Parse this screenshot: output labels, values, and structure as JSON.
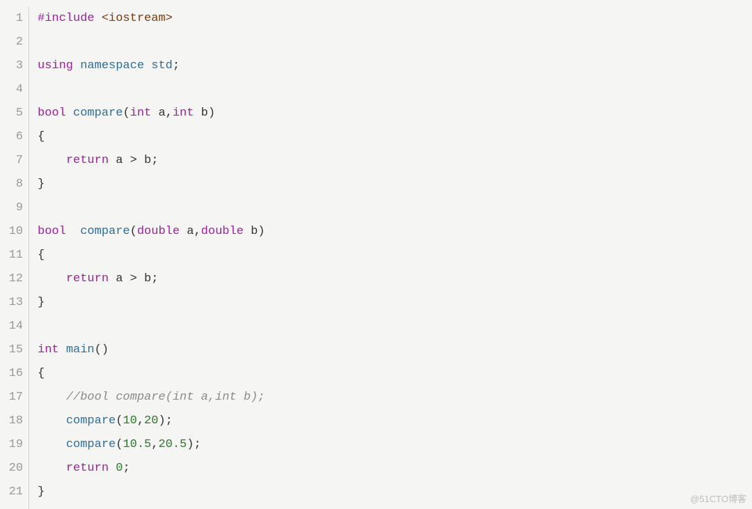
{
  "watermark": "@51CTO博客",
  "code": {
    "lines": [
      {
        "num": "1",
        "tokens": [
          {
            "t": "#include ",
            "c": "kw-preproc"
          },
          {
            "t": "<iostream>",
            "c": "kw-angle"
          }
        ]
      },
      {
        "num": "2",
        "tokens": []
      },
      {
        "num": "3",
        "tokens": [
          {
            "t": "using ",
            "c": "kw-using"
          },
          {
            "t": "namespace ",
            "c": "kw-ns"
          },
          {
            "t": "std",
            "c": "kw-ident"
          },
          {
            "t": ";",
            "c": "op"
          }
        ]
      },
      {
        "num": "4",
        "tokens": []
      },
      {
        "num": "5",
        "tokens": [
          {
            "t": "bool ",
            "c": "kw-type"
          },
          {
            "t": "compare",
            "c": "kw-func"
          },
          {
            "t": "(",
            "c": "op"
          },
          {
            "t": "int ",
            "c": "kw-type"
          },
          {
            "t": "a",
            "c": "op"
          },
          {
            "t": ",",
            "c": "op"
          },
          {
            "t": "int ",
            "c": "kw-type"
          },
          {
            "t": "b",
            "c": "op"
          },
          {
            "t": ")",
            "c": "op"
          }
        ]
      },
      {
        "num": "6",
        "tokens": [
          {
            "t": "{",
            "c": "brace"
          }
        ]
      },
      {
        "num": "7",
        "tokens": [
          {
            "t": "    ",
            "c": ""
          },
          {
            "t": "return ",
            "c": "kw-type"
          },
          {
            "t": "a > b;",
            "c": "op"
          }
        ]
      },
      {
        "num": "8",
        "tokens": [
          {
            "t": "}",
            "c": "brace"
          }
        ]
      },
      {
        "num": "9",
        "tokens": []
      },
      {
        "num": "10",
        "tokens": [
          {
            "t": "bool  ",
            "c": "kw-type"
          },
          {
            "t": "compare",
            "c": "kw-func"
          },
          {
            "t": "(",
            "c": "op"
          },
          {
            "t": "double ",
            "c": "kw-type"
          },
          {
            "t": "a",
            "c": "op"
          },
          {
            "t": ",",
            "c": "op"
          },
          {
            "t": "double ",
            "c": "kw-type"
          },
          {
            "t": "b",
            "c": "op"
          },
          {
            "t": ")",
            "c": "op"
          }
        ]
      },
      {
        "num": "11",
        "tokens": [
          {
            "t": "{",
            "c": "brace"
          }
        ]
      },
      {
        "num": "12",
        "tokens": [
          {
            "t": "    ",
            "c": ""
          },
          {
            "t": "return ",
            "c": "kw-type"
          },
          {
            "t": "a > b;",
            "c": "op"
          }
        ]
      },
      {
        "num": "13",
        "tokens": [
          {
            "t": "}",
            "c": "brace"
          }
        ]
      },
      {
        "num": "14",
        "tokens": []
      },
      {
        "num": "15",
        "tokens": [
          {
            "t": "int ",
            "c": "kw-type"
          },
          {
            "t": "main",
            "c": "kw-func"
          },
          {
            "t": "()",
            "c": "op"
          }
        ]
      },
      {
        "num": "16",
        "tokens": [
          {
            "t": "{",
            "c": "brace"
          }
        ]
      },
      {
        "num": "17",
        "tokens": [
          {
            "t": "    ",
            "c": ""
          },
          {
            "t": "//bool compare(int a,int b);",
            "c": "comment"
          }
        ]
      },
      {
        "num": "18",
        "tokens": [
          {
            "t": "    ",
            "c": ""
          },
          {
            "t": "compare",
            "c": "kw-func"
          },
          {
            "t": "(",
            "c": "op"
          },
          {
            "t": "10",
            "c": "num"
          },
          {
            "t": ",",
            "c": "op"
          },
          {
            "t": "20",
            "c": "num"
          },
          {
            "t": ");",
            "c": "op"
          }
        ]
      },
      {
        "num": "19",
        "tokens": [
          {
            "t": "    ",
            "c": ""
          },
          {
            "t": "compare",
            "c": "kw-func"
          },
          {
            "t": "(",
            "c": "op"
          },
          {
            "t": "10.5",
            "c": "num"
          },
          {
            "t": ",",
            "c": "op"
          },
          {
            "t": "20.5",
            "c": "num"
          },
          {
            "t": ");",
            "c": "op"
          }
        ]
      },
      {
        "num": "20",
        "tokens": [
          {
            "t": "    ",
            "c": ""
          },
          {
            "t": "return ",
            "c": "kw-type"
          },
          {
            "t": "0",
            "c": "num"
          },
          {
            "t": ";",
            "c": "op"
          }
        ]
      },
      {
        "num": "21",
        "tokens": [
          {
            "t": "}",
            "c": "brace"
          }
        ]
      }
    ]
  }
}
